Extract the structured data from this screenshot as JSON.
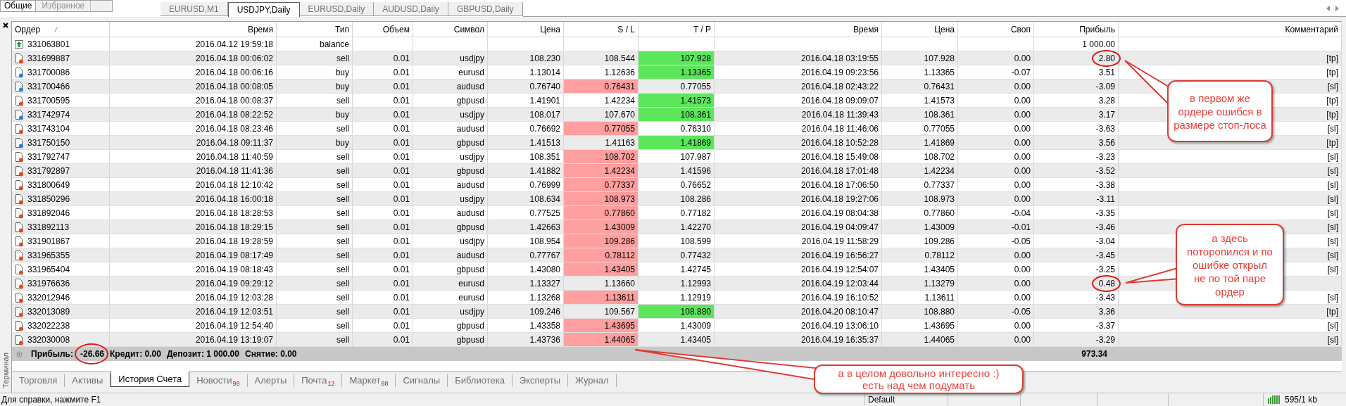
{
  "navigator_tabs": [
    {
      "label": "Общие",
      "selected": true
    },
    {
      "label": "Избранное",
      "selected": false
    }
  ],
  "chart_tabs": [
    {
      "label": "EURUSD,M1",
      "selected": false
    },
    {
      "label": "USDJPY,Daily",
      "selected": true
    },
    {
      "label": "EURUSD,Daily",
      "selected": false
    },
    {
      "label": "AUDUSD,Daily",
      "selected": false
    },
    {
      "label": "GBPUSD,Daily",
      "selected": false
    }
  ],
  "side_label": "Терминал",
  "table": {
    "columns": [
      "Ордер",
      "Время",
      "Тип",
      "Объем",
      "Символ",
      "Цена",
      "S / L",
      "T / P",
      "Время",
      "Цена",
      "Своп",
      "Прибыль",
      "Комментарий"
    ],
    "rows": [
      {
        "kind": "balance",
        "order": "331063801",
        "open_time": "2016.04.12 19:59:18",
        "type": "balance",
        "profit": "1 000.00",
        "sl_hit": false,
        "tp_hit": false,
        "circled": false
      },
      {
        "kind": "sell",
        "order": "331699887",
        "open_time": "2016.04.18 00:06:02",
        "type": "sell",
        "volume": "0.01",
        "symbol": "usdjpy",
        "open_price": "108.230",
        "sl": "108.544",
        "tp": "107.928",
        "close_time": "2016.04.18 03:19:55",
        "close_price": "107.928",
        "swap": "0.00",
        "profit": "2.80",
        "comment": "[tp]",
        "sl_hit": false,
        "tp_hit": true,
        "circled": true
      },
      {
        "kind": "buy",
        "order": "331700086",
        "open_time": "2016.04.18 00:06:16",
        "type": "buy",
        "volume": "0.01",
        "symbol": "eurusd",
        "open_price": "1.13014",
        "sl": "1.12636",
        "tp": "1.13365",
        "close_time": "2016.04.19 09:23:56",
        "close_price": "1.13365",
        "swap": "-0.07",
        "profit": "3.51",
        "comment": "[tp]",
        "sl_hit": false,
        "tp_hit": true,
        "circled": false
      },
      {
        "kind": "buy",
        "order": "331700466",
        "open_time": "2016.04.18 00:08:05",
        "type": "buy",
        "volume": "0.01",
        "symbol": "audusd",
        "open_price": "0.76740",
        "sl": "0.76431",
        "tp": "0.77055",
        "close_time": "2016.04.18 02:43:22",
        "close_price": "0.76431",
        "swap": "0.00",
        "profit": "-3.09",
        "comment": "[sl]",
        "sl_hit": true,
        "tp_hit": false,
        "circled": false
      },
      {
        "kind": "sell",
        "order": "331700595",
        "open_time": "2016.04.18 00:08:37",
        "type": "sell",
        "volume": "0.01",
        "symbol": "gbpusd",
        "open_price": "1.41901",
        "sl": "1.42234",
        "tp": "1.41573",
        "close_time": "2016.04.18 09:09:07",
        "close_price": "1.41573",
        "swap": "0.00",
        "profit": "3.28",
        "comment": "[tp]",
        "sl_hit": false,
        "tp_hit": true,
        "circled": false
      },
      {
        "kind": "buy",
        "order": "331742974",
        "open_time": "2016.04.18 08:22:52",
        "type": "buy",
        "volume": "0.01",
        "symbol": "usdjpy",
        "open_price": "108.017",
        "sl": "107.670",
        "tp": "108.361",
        "close_time": "2016.04.18 11:39:43",
        "close_price": "108.361",
        "swap": "0.00",
        "profit": "3.17",
        "comment": "[tp]",
        "sl_hit": false,
        "tp_hit": true,
        "circled": false
      },
      {
        "kind": "sell",
        "order": "331743104",
        "open_time": "2016.04.18 08:23:46",
        "type": "sell",
        "volume": "0.01",
        "symbol": "audusd",
        "open_price": "0.76692",
        "sl": "0.77055",
        "tp": "0.76310",
        "close_time": "2016.04.18 11:46:06",
        "close_price": "0.77055",
        "swap": "0.00",
        "profit": "-3.63",
        "comment": "[sl]",
        "sl_hit": true,
        "tp_hit": false,
        "circled": false
      },
      {
        "kind": "buy",
        "order": "331750150",
        "open_time": "2016.04.18 09:11:37",
        "type": "buy",
        "volume": "0.01",
        "symbol": "gbpusd",
        "open_price": "1.41513",
        "sl": "1.41163",
        "tp": "1.41869",
        "close_time": "2016.04.18 10:52:28",
        "close_price": "1.41869",
        "swap": "0.00",
        "profit": "3.56",
        "comment": "[tp]",
        "sl_hit": false,
        "tp_hit": true,
        "circled": false
      },
      {
        "kind": "sell",
        "order": "331792747",
        "open_time": "2016.04.18 11:40:59",
        "type": "sell",
        "volume": "0.01",
        "symbol": "usdjpy",
        "open_price": "108.351",
        "sl": "108.702",
        "tp": "107.987",
        "close_time": "2016.04.18 15:49:08",
        "close_price": "108.702",
        "swap": "0.00",
        "profit": "-3.23",
        "comment": "[sl]",
        "sl_hit": true,
        "tp_hit": false,
        "circled": false
      },
      {
        "kind": "sell",
        "order": "331792897",
        "open_time": "2016.04.18 11:41:36",
        "type": "sell",
        "volume": "0.01",
        "symbol": "gbpusd",
        "open_price": "1.41882",
        "sl": "1.42234",
        "tp": "1.41596",
        "close_time": "2016.04.18 17:01:48",
        "close_price": "1.42234",
        "swap": "0.00",
        "profit": "-3.52",
        "comment": "[sl]",
        "sl_hit": true,
        "tp_hit": false,
        "circled": false
      },
      {
        "kind": "sell",
        "order": "331800649",
        "open_time": "2016.04.18 12:10:42",
        "type": "sell",
        "volume": "0.01",
        "symbol": "audusd",
        "open_price": "0.76999",
        "sl": "0.77337",
        "tp": "0.76652",
        "close_time": "2016.04.18 17:06:50",
        "close_price": "0.77337",
        "swap": "0.00",
        "profit": "-3.38",
        "comment": "[sl]",
        "sl_hit": true,
        "tp_hit": false,
        "circled": false
      },
      {
        "kind": "sell",
        "order": "331850296",
        "open_time": "2016.04.18 16:00:18",
        "type": "sell",
        "volume": "0.01",
        "symbol": "usdjpy",
        "open_price": "108.634",
        "sl": "108.973",
        "tp": "108.286",
        "close_time": "2016.04.18 19:27:06",
        "close_price": "108.973",
        "swap": "0.00",
        "profit": "-3.11",
        "comment": "[sl]",
        "sl_hit": true,
        "tp_hit": false,
        "circled": false
      },
      {
        "kind": "sell",
        "order": "331892046",
        "open_time": "2016.04.18 18:28:53",
        "type": "sell",
        "volume": "0.01",
        "symbol": "audusd",
        "open_price": "0.77525",
        "sl": "0.77860",
        "tp": "0.77182",
        "close_time": "2016.04.19 08:04:38",
        "close_price": "0.77860",
        "swap": "-0.04",
        "profit": "-3.35",
        "comment": "[sl]",
        "sl_hit": true,
        "tp_hit": false,
        "circled": false
      },
      {
        "kind": "sell",
        "order": "331892113",
        "open_time": "2016.04.18 18:29:15",
        "type": "sell",
        "volume": "0.01",
        "symbol": "gbpusd",
        "open_price": "1.42663",
        "sl": "1.43009",
        "tp": "1.42270",
        "close_time": "2016.04.19 04:09:47",
        "close_price": "1.43009",
        "swap": "-0.01",
        "profit": "-3.46",
        "comment": "[sl]",
        "sl_hit": true,
        "tp_hit": false,
        "circled": false
      },
      {
        "kind": "sell",
        "order": "331901867",
        "open_time": "2016.04.18 19:28:59",
        "type": "sell",
        "volume": "0.01",
        "symbol": "usdjpy",
        "open_price": "108.954",
        "sl": "109.286",
        "tp": "108.599",
        "close_time": "2016.04.19 11:58:29",
        "close_price": "109.286",
        "swap": "-0.05",
        "profit": "-3.04",
        "comment": "[sl]",
        "sl_hit": true,
        "tp_hit": false,
        "circled": false
      },
      {
        "kind": "sell",
        "order": "331965355",
        "open_time": "2016.04.19 08:17:49",
        "type": "sell",
        "volume": "0.01",
        "symbol": "audusd",
        "open_price": "0.77767",
        "sl": "0.78112",
        "tp": "0.77432",
        "close_time": "2016.04.19 16:56:27",
        "close_price": "0.78112",
        "swap": "0.00",
        "profit": "-3.45",
        "comment": "[sl]",
        "sl_hit": true,
        "tp_hit": false,
        "circled": false
      },
      {
        "kind": "sell",
        "order": "331965404",
        "open_time": "2016.04.19 08:18:43",
        "type": "sell",
        "volume": "0.01",
        "symbol": "gbpusd",
        "open_price": "1.43080",
        "sl": "1.43405",
        "tp": "1.42745",
        "close_time": "2016.04.19 12:54:07",
        "close_price": "1.43405",
        "swap": "0.00",
        "profit": "-3.25",
        "comment": "[sl]",
        "sl_hit": true,
        "tp_hit": false,
        "circled": false
      },
      {
        "kind": "sell",
        "order": "331976636",
        "open_time": "2016.04.19 09:29:12",
        "type": "sell",
        "volume": "0.01",
        "symbol": "eurusd",
        "open_price": "1.13327",
        "sl": "1.13660",
        "tp": "1.12993",
        "close_time": "2016.04.19 12:03:44",
        "close_price": "1.13279",
        "swap": "0.00",
        "profit": "0.48",
        "sl_hit": false,
        "tp_hit": false,
        "circled": true
      },
      {
        "kind": "sell",
        "order": "332012946",
        "open_time": "2016.04.19 12:03:28",
        "type": "sell",
        "volume": "0.01",
        "symbol": "eurusd",
        "open_price": "1.13268",
        "sl": "1.13611",
        "tp": "1.12919",
        "close_time": "2016.04.19 16:10:52",
        "close_price": "1.13611",
        "swap": "0.00",
        "profit": "-3.43",
        "comment": "[sl]",
        "sl_hit": true,
        "tp_hit": false,
        "circled": false
      },
      {
        "kind": "sell",
        "order": "332013089",
        "open_time": "2016.04.19 12:03:51",
        "type": "sell",
        "volume": "0.01",
        "symbol": "usdjpy",
        "open_price": "109.246",
        "sl": "109.567",
        "tp": "108.880",
        "close_time": "2016.04.20 08:10:47",
        "close_price": "108.880",
        "swap": "-0.05",
        "profit": "3.36",
        "comment": "[tp]",
        "sl_hit": false,
        "tp_hit": true,
        "circled": false
      },
      {
        "kind": "sell",
        "order": "332022238",
        "open_time": "2016.04.19 12:54:40",
        "type": "sell",
        "volume": "0.01",
        "symbol": "gbpusd",
        "open_price": "1.43358",
        "sl": "1.43695",
        "tp": "1.43009",
        "close_time": "2016.04.19 13:06:10",
        "close_price": "1.43695",
        "swap": "0.00",
        "profit": "-3.37",
        "comment": "[sl]",
        "sl_hit": true,
        "tp_hit": false,
        "circled": false
      },
      {
        "kind": "sell",
        "order": "332030008",
        "open_time": "2016.04.19 13:19:07",
        "type": "sell",
        "volume": "0.01",
        "symbol": "gbpusd",
        "open_price": "1.43736",
        "sl": "1.44065",
        "tp": "1.43405",
        "close_time": "2016.04.19 16:35:37",
        "close_price": "1.44065",
        "swap": "0.00",
        "profit": "-3.29",
        "comment": "[sl]",
        "sl_hit": true,
        "tp_hit": false,
        "circled": false
      }
    ]
  },
  "summary": {
    "profit_label": "Прибыль:",
    "profit": "-26.66",
    "profit_circled": true,
    "credit": "Кредит: 0.00",
    "deposit": "Депозит: 1 000.00",
    "withdrawal": "Снятие: 0.00",
    "total": "973.34"
  },
  "bottom_tabs": [
    {
      "label": "Торговля",
      "selected": false
    },
    {
      "label": "Активы",
      "selected": false
    },
    {
      "label": "История Счета",
      "selected": true
    },
    {
      "label": "Новости",
      "badge": "99",
      "selected": false
    },
    {
      "label": "Алерты",
      "selected": false
    },
    {
      "label": "Почта",
      "badge": "12",
      "selected": false
    },
    {
      "label": "Маркет",
      "badge": "88",
      "selected": false
    },
    {
      "label": "Сигналы",
      "selected": false
    },
    {
      "label": "Библиотека",
      "selected": false
    },
    {
      "label": "Эксперты",
      "selected": false
    },
    {
      "label": "Журнал",
      "selected": false
    }
  ],
  "status_bar": {
    "help": "Для справки, нажмите F1",
    "profile": "Default",
    "traffic": "595/1 kb"
  },
  "annotations": [
    {
      "text": "в первом же ордере ошибся в размере стоп-лоса"
    },
    {
      "text": "а здесь поторопился и по ошибке открыл не по той паре ордер"
    },
    {
      "text": "а в целом довольно интересно :) есть над чем подумать"
    }
  ]
}
